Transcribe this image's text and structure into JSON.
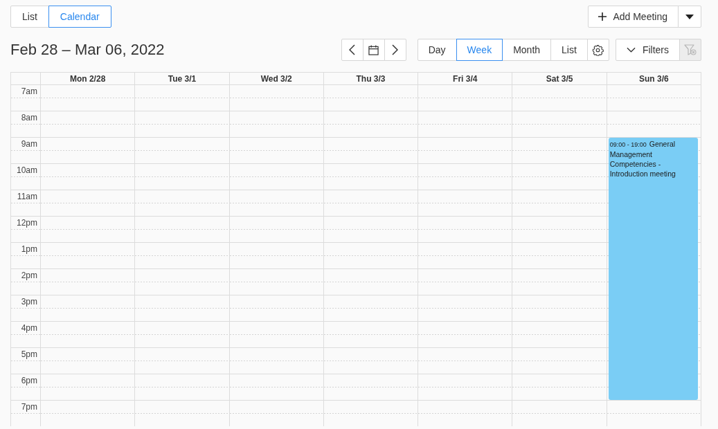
{
  "view_switch": [
    {
      "label": "List",
      "selected": false
    },
    {
      "label": "Calendar",
      "selected": true
    }
  ],
  "add_meeting": {
    "label": "Add Meeting"
  },
  "title": "Feb 28 – Mar 06, 2022",
  "view_modes": [
    {
      "label": "Day",
      "selected": false
    },
    {
      "label": "Week",
      "selected": true
    },
    {
      "label": "Month",
      "selected": false
    },
    {
      "label": "List",
      "selected": false
    }
  ],
  "filters": {
    "label": "Filters",
    "clear_disabled": true
  },
  "calendar": {
    "hours": [
      "7am",
      "8am",
      "9am",
      "10am",
      "11am",
      "12pm",
      "1pm",
      "2pm",
      "3pm",
      "4pm",
      "5pm",
      "6pm",
      "7pm"
    ],
    "days": [
      {
        "label": "Mon 2/28"
      },
      {
        "label": "Tue 3/1"
      },
      {
        "label": "Wed 3/2"
      },
      {
        "label": "Thu 3/3"
      },
      {
        "label": "Fri 3/4"
      },
      {
        "label": "Sat 3/5"
      },
      {
        "label": "Sun 3/6",
        "events": [
          {
            "time": "09:00 - 19:00",
            "title": "General Management Competencies - Introduction meeting",
            "color": "#7acdf5"
          }
        ]
      }
    ]
  }
}
